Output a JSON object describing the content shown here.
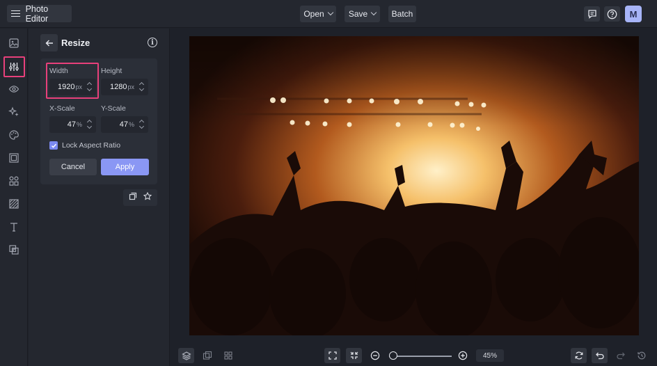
{
  "app": {
    "title": "Photo Editor"
  },
  "toolbar": {
    "open_label": "Open",
    "save_label": "Save",
    "batch_label": "Batch"
  },
  "user": {
    "avatar_initial": "M"
  },
  "panel": {
    "title": "Resize",
    "width": {
      "label": "Width",
      "value": "1920",
      "unit": "px"
    },
    "height": {
      "label": "Height",
      "value": "1280",
      "unit": "px"
    },
    "xscale": {
      "label": "X-Scale",
      "value": "47",
      "unit": "%"
    },
    "yscale": {
      "label": "Y-Scale",
      "value": "47",
      "unit": "%"
    },
    "lock_label": "Lock Aspect Ratio",
    "lock_checked": true,
    "cancel_label": "Cancel",
    "apply_label": "Apply"
  },
  "zoom": {
    "label": "45%",
    "level": 0.45
  },
  "colors": {
    "accent": "#8a97f4",
    "highlight": "#e8407b",
    "background": "#1e2129",
    "panel": "#24272f"
  }
}
